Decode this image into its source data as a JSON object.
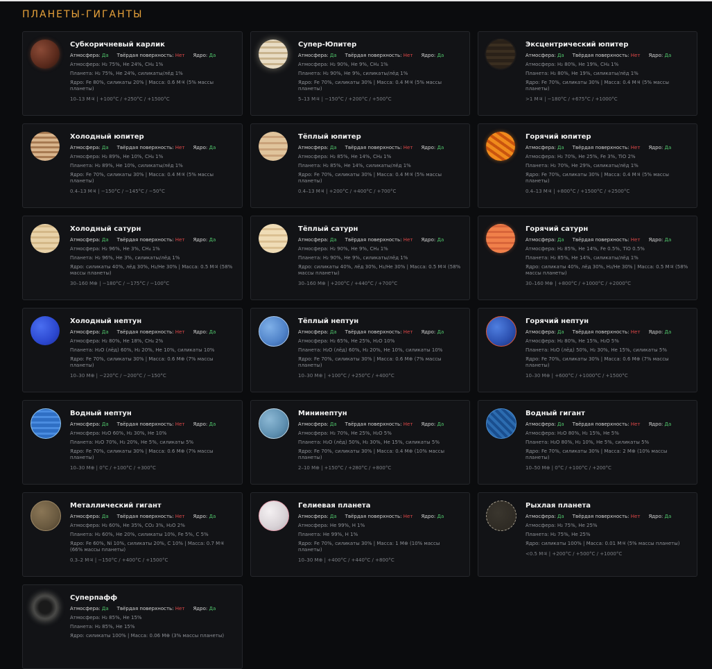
{
  "header": {
    "title": "ПЛАНЕТЫ-ГИГАНТЫ"
  },
  "labels": {
    "atmosphere": "Атмосфера:",
    "surface": "Твёрдая поверхность:",
    "core": "Ядро:",
    "yes": "Да",
    "no": "Нет"
  },
  "colors": {
    "accent": "#e8a33b",
    "yes": "#4fc26a",
    "no": "#e04848"
  },
  "cards": [
    {
      "name": "Субкоричневый карлик",
      "atm": "Да",
      "surf": "Нет",
      "core": "Да",
      "atm_line": "Атмосфера: H₂ 75%, He 24%, CH₄ 1%",
      "planet_line": "Планета: H₂ 75%, He 24%, силикаты/лёд 1%",
      "core_line": "Ядро: Fe 80%, силикаты 20% | Масса: 0.6 M♃ (5% массы планеты)",
      "range": "10–13 M♃ | +100°C / +250°C / +1500°C",
      "icon": "planet-subbrown-dwarf-icon"
    },
    {
      "name": "Супер-Юпитер",
      "atm": "Да",
      "surf": "Нет",
      "core": "Да",
      "atm_line": "Атмосфера: H₂ 90%, He 9%, CH₄ 1%",
      "planet_line": "Планета: H₂ 90%, He 9%, силикаты/лёд 1%",
      "core_line": "Ядро: Fe 70%, силикаты 30% | Масса: 0.4 M♃ (5% массы планеты)",
      "range": "5–13 M♃ | −150°C / +200°C / +500°C",
      "icon": "planet-super-jupiter-icon"
    },
    {
      "name": "Эксцентрический юпитер",
      "atm": "Да",
      "surf": "Нет",
      "core": "Да",
      "atm_line": "Атмосфера: H₂ 80%, He 19%, CH₄ 1%",
      "planet_line": "Планета: H₂ 80%, He 19%, силикаты/лёд 1%",
      "core_line": "Ядро: Fe 70%, силикаты 30% | Масса: 0.4 M♃ (5% массы планеты)",
      "range": ">1 M♃ | −180°C / +675°C / +1000°C",
      "icon": "planet-eccentric-jupiter-icon"
    },
    {
      "name": "Холодный юпитер",
      "atm": "Да",
      "surf": "Нет",
      "core": "Да",
      "atm_line": "Атмосфера: H₂ 89%, He 10%, CH₄ 1%",
      "planet_line": "Планета: H₂ 89%, He 10%, силикаты/лёд 1%",
      "core_line": "Ядро: Fe 70%, силикаты 30% | Масса: 0.4 M♃ (5% массы планеты)",
      "range": "0.4–13 M♃ | −150°C / −145°C / −50°C",
      "icon": "planet-cold-jupiter-icon"
    },
    {
      "name": "Тёплый юпитер",
      "atm": "Да",
      "surf": "Нет",
      "core": "Да",
      "atm_line": "Атмосфера: H₂ 85%, He 14%, CH₄ 1%",
      "planet_line": "Планета: H₂ 85%, He 14%, силикаты/лёд 1%",
      "core_line": "Ядро: Fe 70%, силикаты 30% | Масса: 0.4 M♃ (5% массы планеты)",
      "range": "0.4–13 M♃ | +200°C / +400°C / +700°C",
      "icon": "planet-warm-jupiter-icon"
    },
    {
      "name": "Горячий юпитер",
      "atm": "Да",
      "surf": "Нет",
      "core": "Да",
      "atm_line": "Атмосфера: H₂ 70%, He 25%, Fe 3%, TiO 2%",
      "planet_line": "Планета: H₂ 70%, He 29%, силикаты/лёд 1%",
      "core_line": "Ядро: Fe 70%, силикаты 30% | Масса: 0.4 M♃ (5% массы планеты)",
      "range": "0.4–13 M♃ | +800°C / +1500°C / +2500°C",
      "icon": "planet-hot-jupiter-icon"
    },
    {
      "name": "Холодный сатурн",
      "atm": "Да",
      "surf": "Нет",
      "core": "Да",
      "atm_line": "Атмосфера: H₂ 96%, He 3%, CH₄ 1%",
      "planet_line": "Планета: H₂ 96%, He 3%, силикаты/лёд 1%",
      "core_line": "Ядро: силикаты 40%, лёд 30%, H₂/He 30% | Масса: 0.5 M♃ (58% массы планеты)",
      "range": "30–160 M⊕ | −180°C / −175°C / −100°C",
      "icon": "planet-cold-saturn-icon"
    },
    {
      "name": "Тёплый сатурн",
      "atm": "Да",
      "surf": "Нет",
      "core": "Да",
      "atm_line": "Атмосфера: H₂ 90%, He 9%, CH₄ 1%",
      "planet_line": "Планета: H₂ 90%, He 9%, силикаты/лёд 1%",
      "core_line": "Ядро: силикаты 40%, лёд 30%, H₂/He 30% | Масса: 0.5 M♃ (58% массы планеты)",
      "range": "30–160 M⊕ | +200°C / +440°C / +700°C",
      "icon": "planet-warm-saturn-icon"
    },
    {
      "name": "Горячий сатурн",
      "atm": "Да",
      "surf": "Нет",
      "core": "Да",
      "atm_line": "Атмосфера: H₂ 85%, He 14%, Fe 0.5%, TiO 0.5%",
      "planet_line": "Планета: H₂ 85%, He 14%, силикаты/лёд 1%",
      "core_line": "Ядро: силикаты 40%, лёд 30%, H₂/He 30% | Масса: 0.5 M♃ (58% массы планеты)",
      "range": "30–160 M⊕ | +800°C / +1000°C / +2000°C",
      "icon": "planet-hot-saturn-icon"
    },
    {
      "name": "Холодный нептун",
      "atm": "Да",
      "surf": "Нет",
      "core": "Да",
      "atm_line": "Атмосфера: H₂ 80%, He 18%, CH₄ 2%",
      "planet_line": "Планета: H₂O (лёд) 60%, H₂ 20%, He 10%, силикаты 10%",
      "core_line": "Ядро: Fe 70%, силикаты 30% | Масса: 0.6 M⊕ (7% массы планеты)",
      "range": "10–30 M⊕ | −220°C / −200°C / −150°C",
      "icon": "planet-cold-neptune-icon"
    },
    {
      "name": "Тёплый нептун",
      "atm": "Да",
      "surf": "Нет",
      "core": "Да",
      "atm_line": "Атмосфера: H₂ 65%, He 25%, H₂O 10%",
      "planet_line": "Планета: H₂O (лёд) 60%, H₂ 20%, He 10%, силикаты 10%",
      "core_line": "Ядро: Fe 70%, силикаты 30% | Масса: 0.6 M⊕ (7% массы планеты)",
      "range": "10–30 M⊕ | +100°C / +250°C / +400°C",
      "icon": "planet-warm-neptune-icon"
    },
    {
      "name": "Горячий нептун",
      "atm": "Да",
      "surf": "Нет",
      "core": "Да",
      "atm_line": "Атмосфера: H₂ 80%, He 15%, H₂O 5%",
      "planet_line": "Планета: H₂O (лёд) 50%, H₂ 30%, He 15%, силикаты 5%",
      "core_line": "Ядро: Fe 70%, силикаты 30% | Масса: 0.6 M⊕ (7% массы планеты)",
      "range": "10–30 M⊕ | +600°C / +1000°C / +1500°C",
      "icon": "planet-hot-neptune-icon"
    },
    {
      "name": "Водный нептун",
      "atm": "Да",
      "surf": "Нет",
      "core": "Да",
      "atm_line": "Атмосфера: H₂O 60%, H₂ 30%, He 10%",
      "planet_line": "Планета: H₂O 70%, H₂ 20%, He 5%, силикаты 5%",
      "core_line": "Ядро: Fe 70%, силикаты 30% | Масса: 0.6 M⊕ (7% массы планеты)",
      "range": "10–30 M⊕ | 0°C / +100°C / +300°C",
      "icon": "planet-water-neptune-icon"
    },
    {
      "name": "Мининептун",
      "atm": "Да",
      "surf": "Нет",
      "core": "Да",
      "atm_line": "Атмосфера: H₂ 70%, He 25%, H₂O 5%",
      "planet_line": "Планета: H₂O (лёд) 50%, H₂ 30%, He 15%, силикаты 5%",
      "core_line": "Ядро: Fe 70%, силикаты 30% | Масса: 0.4 M⊕ (10% массы планеты)",
      "range": "2–10 M⊕ | +150°C / +280°C / +800°C",
      "icon": "planet-mini-neptune-icon"
    },
    {
      "name": "Водный гигант",
      "atm": "Да",
      "surf": "Нет",
      "core": "Да",
      "atm_line": "Атмосфера: H₂O 80%, H₂ 15%, He 5%",
      "planet_line": "Планета: H₂O 80%, H₂ 10%, He 5%, силикаты 5%",
      "core_line": "Ядро: Fe 70%, силикаты 30% | Масса: 2 M⊕ (10% массы планеты)",
      "range": "10–50 M⊕ | 0°C / +100°C / +200°C",
      "icon": "planet-water-giant-icon"
    },
    {
      "name": "Металлический гигант",
      "atm": "Да",
      "surf": "Нет",
      "core": "Да",
      "atm_line": "Атмосфера: H₂ 60%, He 35%, CO₂ 3%, H₂O 2%",
      "planet_line": "Планета: H₂ 60%, He 20%, силикаты 10%, Fe 5%, C 5%",
      "core_line": "Ядро: Fe 60%, Ni 10%, силикаты 20%, C 10% | Масса: 0.7 M♃ (66% массы планеты)",
      "range": "0.3–2 M♃ | −150°C / +400°C / +1500°C",
      "icon": "planet-metal-giant-icon"
    },
    {
      "name": "Гелиевая планета",
      "atm": "Да",
      "surf": "Нет",
      "core": "Да",
      "atm_line": "Атмосфера: He 99%, H 1%",
      "planet_line": "Планета: He 99%, H 1%",
      "core_line": "Ядро: Fe 70%, силикаты 30% | Масса: 1 M⊕ (10% массы планеты)",
      "range": "10–30 M⊕ | +400°C / +440°C / +800°C",
      "icon": "planet-helium-icon"
    },
    {
      "name": "Рыхлая планета",
      "atm": "Да",
      "surf": "Нет",
      "core": "Да",
      "atm_line": "Атмосфера: H₂ 75%, He 25%",
      "planet_line": "Планета: H₂ 75%, He 25%",
      "core_line": "Ядро: силикаты 100% | Масса: 0.01 M♃ (5% массы планеты)",
      "range": "<0.5 M♃ | +200°C / +500°C / +1000°C",
      "icon": "planet-puffy-icon"
    },
    {
      "name": "Суперпафф",
      "atm": "Да",
      "surf": "Нет",
      "core": "Да",
      "atm_line": "Атмосфера: H₂ 85%, He 15%",
      "planet_line": "Планета: H₂ 85%, He 15%",
      "core_line": "Ядро: силикаты 100% | Масса: 0.06 M⊕ (3% массы планеты)",
      "range": "",
      "icon": "planet-superpuff-icon"
    }
  ]
}
